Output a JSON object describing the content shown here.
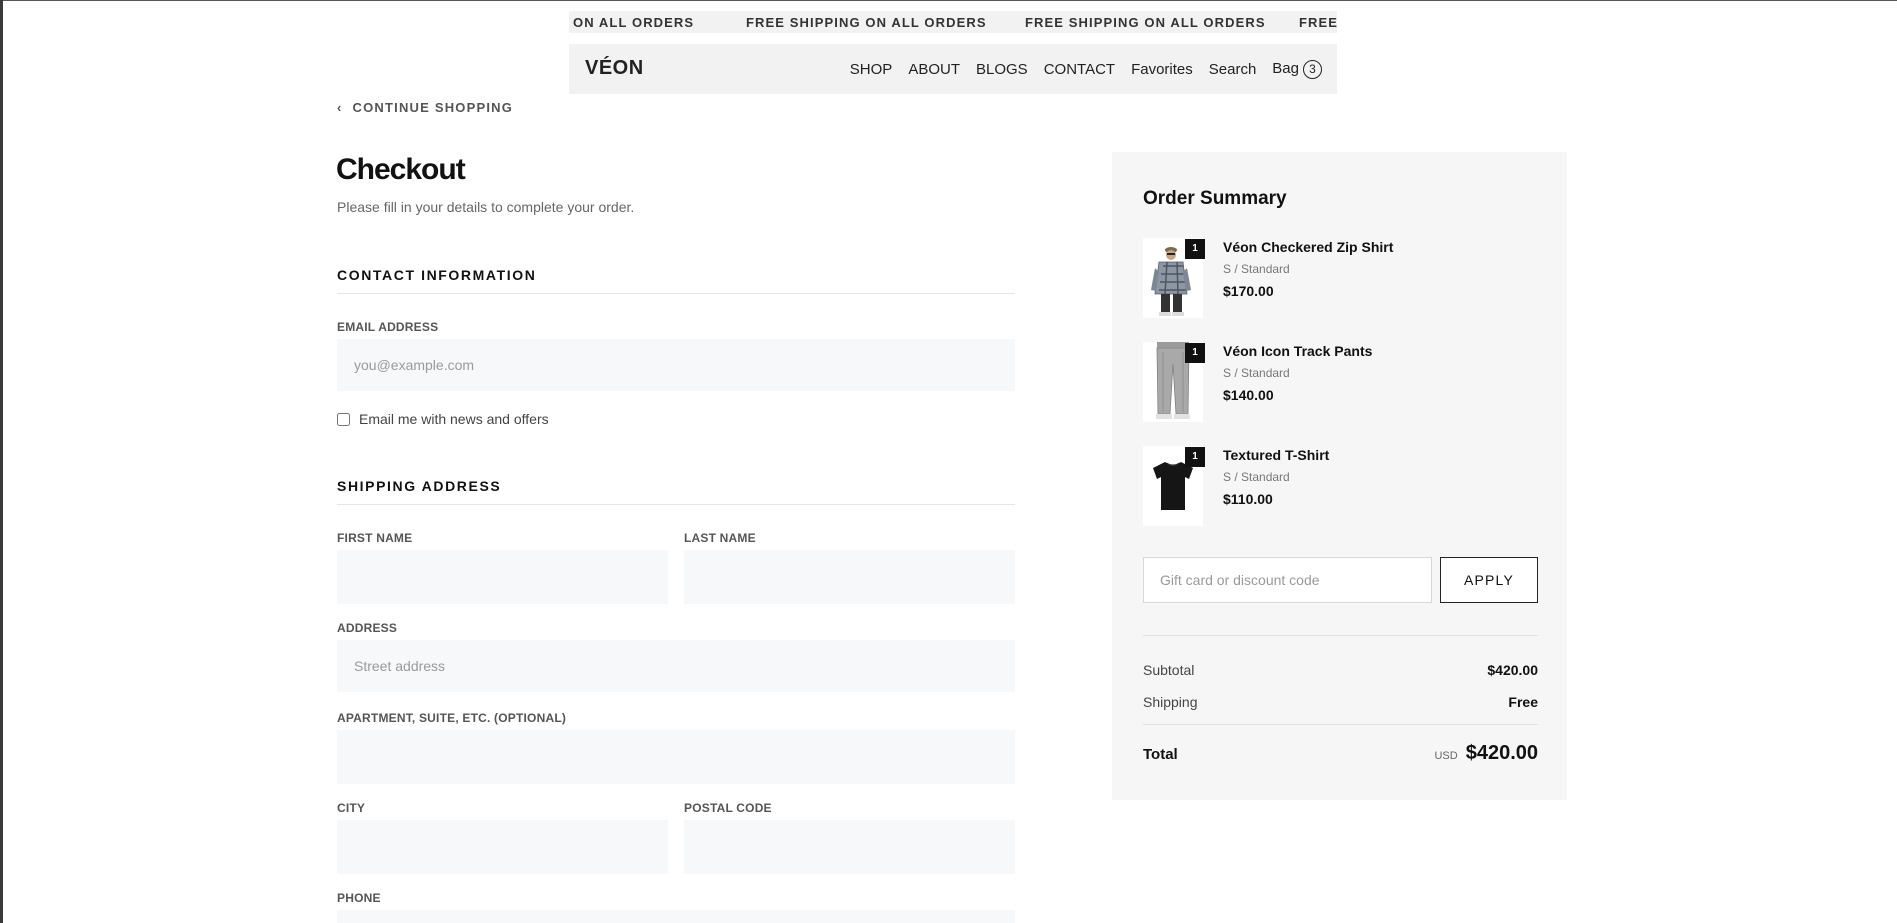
{
  "announcement": {
    "items": [
      "ON ALL ORDERS",
      "FREE SHIPPING ON ALL ORDERS",
      "FREE SHIPPING ON ALL ORDERS",
      "FREE"
    ]
  },
  "header": {
    "logo": "VÉON",
    "nav": [
      "SHOP",
      "ABOUT",
      "BLOGS",
      "CONTACT",
      "Favorites",
      "Search",
      "Bag"
    ],
    "bag_count": "3"
  },
  "continue_label": "CONTINUE SHOPPING",
  "checkout": {
    "title": "Checkout",
    "subtitle": "Please fill in your details to complete your order.",
    "contact": {
      "heading": "CONTACT INFORMATION",
      "email_label": "EMAIL ADDRESS",
      "email_placeholder": "you@example.com",
      "email_value": "",
      "newsletter_label": "Email me with news and offers",
      "newsletter_checked": false
    },
    "shipping": {
      "heading": "SHIPPING ADDRESS",
      "first_name_label": "FIRST NAME",
      "last_name_label": "LAST NAME",
      "address_label": "ADDRESS",
      "address_placeholder": "Street address",
      "apartment_label": "APARTMENT, SUITE, ETC. (OPTIONAL)",
      "city_label": "CITY",
      "postal_label": "POSTAL CODE",
      "phone_label": "PHONE"
    }
  },
  "summary": {
    "title": "Order Summary",
    "items": [
      {
        "name": "Véon Checkered Zip Shirt",
        "variant": "S / Standard",
        "price": "$170.00",
        "qty": "1"
      },
      {
        "name": "Véon Icon Track Pants",
        "variant": "S / Standard",
        "price": "$140.00",
        "qty": "1"
      },
      {
        "name": "Textured T-Shirt",
        "variant": "S / Standard",
        "price": "$110.00",
        "qty": "1"
      }
    ],
    "discount_placeholder": "Gift card or discount code",
    "apply_label": "APPLY",
    "subtotal_label": "Subtotal",
    "subtotal_value": "$420.00",
    "shipping_label": "Shipping",
    "shipping_value": "Free",
    "total_label": "Total",
    "total_currency": "USD",
    "total_value": "$420.00"
  }
}
